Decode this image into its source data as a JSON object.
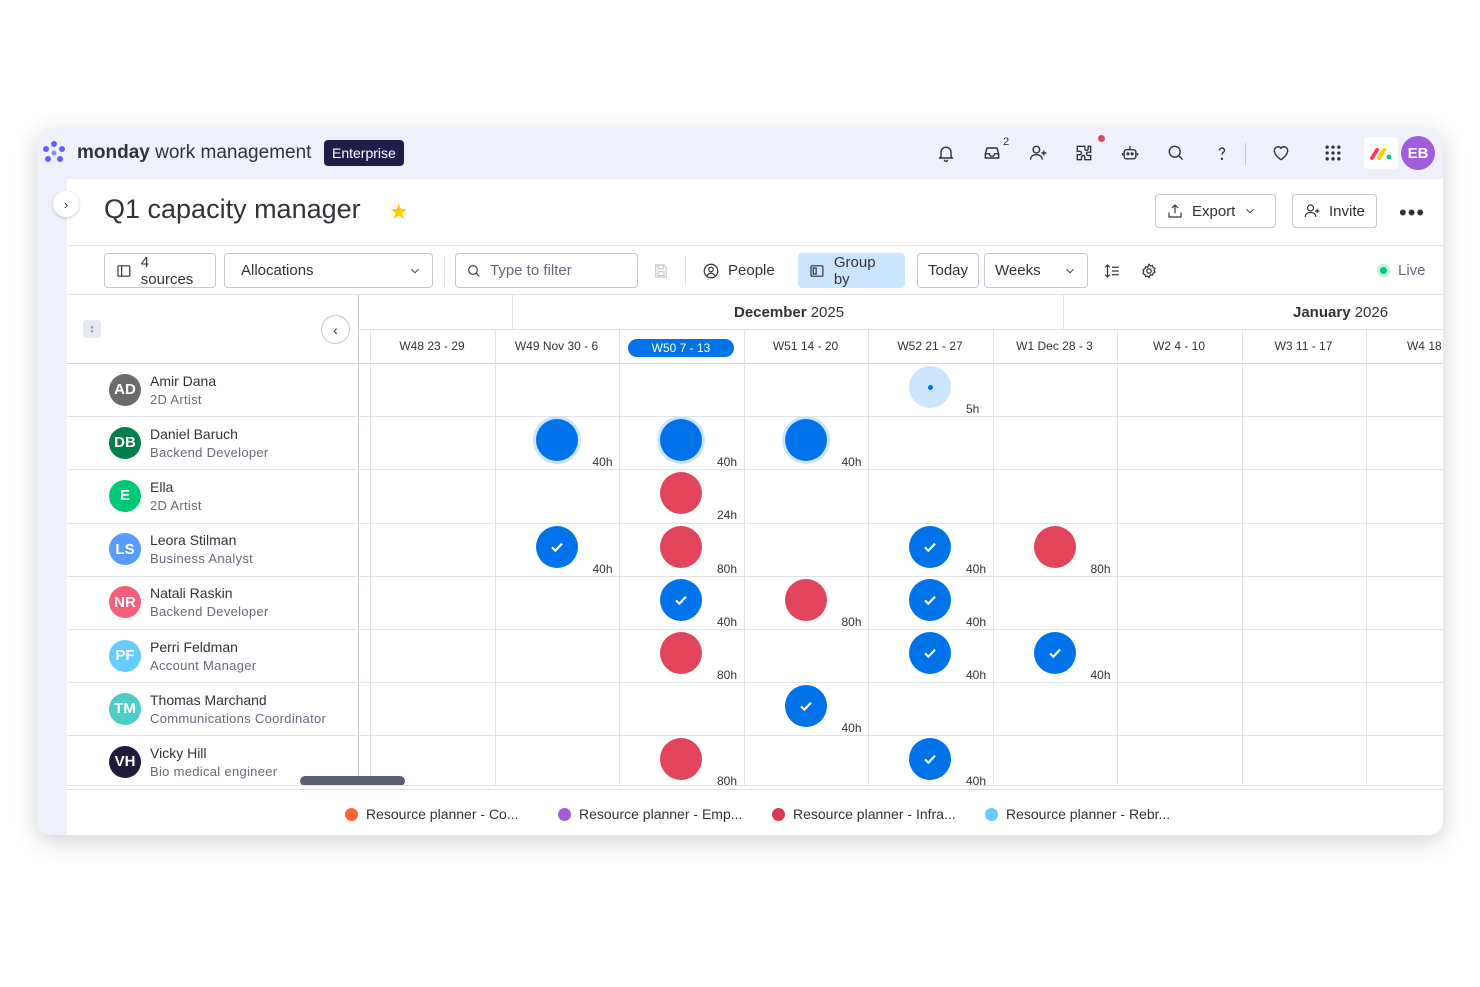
{
  "app": {
    "brand_bold": "monday",
    "brand_rest": " work management",
    "plan_badge": "Enterprise",
    "inbox_count": "2",
    "user_initials": "EB"
  },
  "page": {
    "title": "Q1 capacity manager",
    "export_label": "Export",
    "invite_label": "Invite"
  },
  "toolbar": {
    "sources_label": "4 sources",
    "view_select": "Allocations",
    "filter_placeholder": "Type to filter",
    "people_label": "People",
    "group_by_label": "Group by",
    "today_label": "Today",
    "scale_select": "Weeks",
    "live_label": "Live"
  },
  "timeline": {
    "months": [
      {
        "bold": "December",
        "rest": " 2025"
      },
      {
        "bold": "January",
        "rest": " 2026"
      }
    ],
    "weeks": [
      "W48 23 - 29",
      "W49 Nov 30 - 6",
      "W50 7 - 13",
      "W51 14 - 20",
      "W52 21 - 27",
      "W1 Dec 28 - 3",
      "W2 4 - 10",
      "W3 11 - 17",
      "W4 18 -"
    ],
    "current_week_index": 2
  },
  "people": [
    {
      "initials": "AD",
      "name": "Amir Dana",
      "role": "2D Artist",
      "color": "#6b6b6b"
    },
    {
      "initials": "DB",
      "name": "Daniel Baruch",
      "role": "Backend Developer",
      "color": "#037f4c"
    },
    {
      "initials": "E",
      "name": "Ella",
      "role": "2D Artist",
      "color": "#00c875"
    },
    {
      "initials": "LS",
      "name": "Leora Stilman",
      "role": "Business Analyst",
      "color": "#579bfc"
    },
    {
      "initials": "NR",
      "name": "Natali Raskin",
      "role": "Backend Developer",
      "color": "#f65f7c"
    },
    {
      "initials": "PF",
      "name": "Perri Feldman",
      "role": "Account Manager",
      "color": "#66ccff"
    },
    {
      "initials": "TM",
      "name": "Thomas Marchand",
      "role": "Communications Coordinator",
      "color": "#4eccc6"
    },
    {
      "initials": "VH",
      "name": "Vicky Hill",
      "role": "Bio medical engineer",
      "color": "#1f1d3a"
    }
  ],
  "allocations": [
    {
      "row": 0,
      "week": 4,
      "style": "light",
      "hours": "5h"
    },
    {
      "row": 1,
      "week": 1,
      "style": "blue-ring",
      "hours": "40h"
    },
    {
      "row": 1,
      "week": 2,
      "style": "blue-ring",
      "hours": "40h"
    },
    {
      "row": 1,
      "week": 3,
      "style": "blue-ring",
      "hours": "40h"
    },
    {
      "row": 2,
      "week": 2,
      "style": "red",
      "hours": "24h"
    },
    {
      "row": 3,
      "week": 1,
      "style": "blue-check",
      "hours": "40h"
    },
    {
      "row": 3,
      "week": 2,
      "style": "red",
      "hours": "80h"
    },
    {
      "row": 3,
      "week": 4,
      "style": "blue-check",
      "hours": "40h"
    },
    {
      "row": 3,
      "week": 5,
      "style": "red",
      "hours": "80h"
    },
    {
      "row": 4,
      "week": 2,
      "style": "blue-check",
      "hours": "40h"
    },
    {
      "row": 4,
      "week": 3,
      "style": "red",
      "hours": "80h"
    },
    {
      "row": 4,
      "week": 4,
      "style": "blue-check",
      "hours": "40h"
    },
    {
      "row": 5,
      "week": 2,
      "style": "red",
      "hours": "80h"
    },
    {
      "row": 5,
      "week": 4,
      "style": "blue-check",
      "hours": "40h"
    },
    {
      "row": 5,
      "week": 5,
      "style": "blue-check",
      "hours": "40h"
    },
    {
      "row": 6,
      "week": 3,
      "style": "blue-check",
      "hours": "40h"
    },
    {
      "row": 7,
      "week": 2,
      "style": "red",
      "hours": "80h"
    },
    {
      "row": 7,
      "week": 4,
      "style": "blue-check",
      "hours": "40h"
    }
  ],
  "legend": [
    {
      "label": "Resource planner - Co...",
      "color": "#ff642e"
    },
    {
      "label": "Resource planner - Emp...",
      "color": "#a25ddc"
    },
    {
      "label": "Resource planner - Infra...",
      "color": "#d83a52"
    },
    {
      "label": "Resource planner - Rebr...",
      "color": "#66ccff"
    }
  ],
  "colors": {
    "accent": "#0073ea",
    "red": "#e2445c",
    "live": "#00c875"
  }
}
